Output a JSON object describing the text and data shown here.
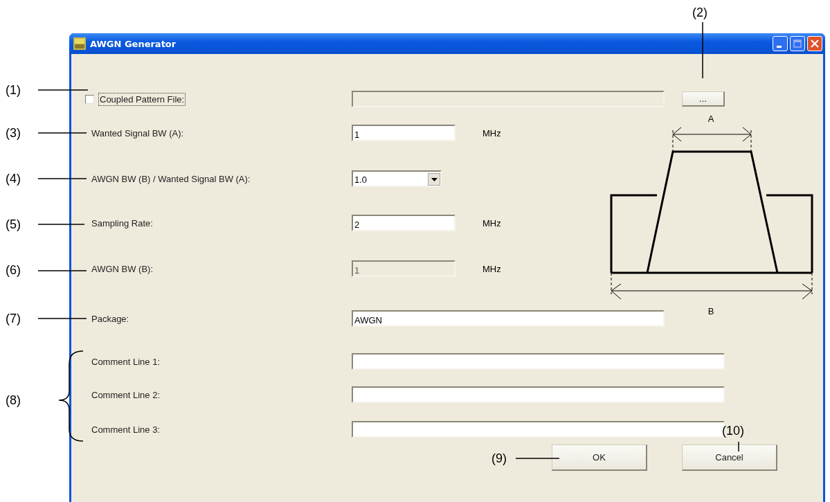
{
  "window": {
    "title": "AWGN Generator"
  },
  "coupled_file": {
    "label": "Coupled Pattern File:",
    "checked": false,
    "path_disabled": true,
    "browse_button": "..."
  },
  "rows": [
    {
      "kind": "text",
      "label": "Wanted Signal BW (A):",
      "value": "1",
      "unit": "MHz",
      "disabled": false
    },
    {
      "kind": "dropdown",
      "label": "AWGN BW (B) / Wanted Signal BW (A):",
      "value": "1.0",
      "disabled": false
    },
    {
      "kind": "text",
      "label": "Sampling Rate:",
      "value": "2",
      "unit": "MHz",
      "disabled": false
    },
    {
      "kind": "text",
      "label": "AWGN BW (B):",
      "value": "1",
      "unit": "MHz",
      "disabled": true
    },
    {
      "kind": "wide",
      "label": "Package:",
      "value": "AWGN",
      "disabled": false
    },
    {
      "kind": "comment",
      "label": "Comment Line 1:",
      "value": "",
      "disabled": false
    },
    {
      "kind": "comment",
      "label": "Comment Line 2:",
      "value": "",
      "disabled": false
    },
    {
      "kind": "comment",
      "label": "Comment Line 3:",
      "value": "",
      "disabled": false
    }
  ],
  "diagram": {
    "label_a": "A",
    "label_b": "B"
  },
  "buttons": [
    "OK",
    "Cancel"
  ],
  "callouts": [
    {
      "label": "(1)"
    },
    {
      "label": "(2)"
    },
    {
      "label": "(3)"
    },
    {
      "label": "(4)"
    },
    {
      "label": "(5)"
    },
    {
      "label": "(6)"
    },
    {
      "label": "(7)"
    },
    {
      "label": "(8)"
    },
    {
      "label": "(9)"
    },
    {
      "label": "(10)"
    }
  ]
}
